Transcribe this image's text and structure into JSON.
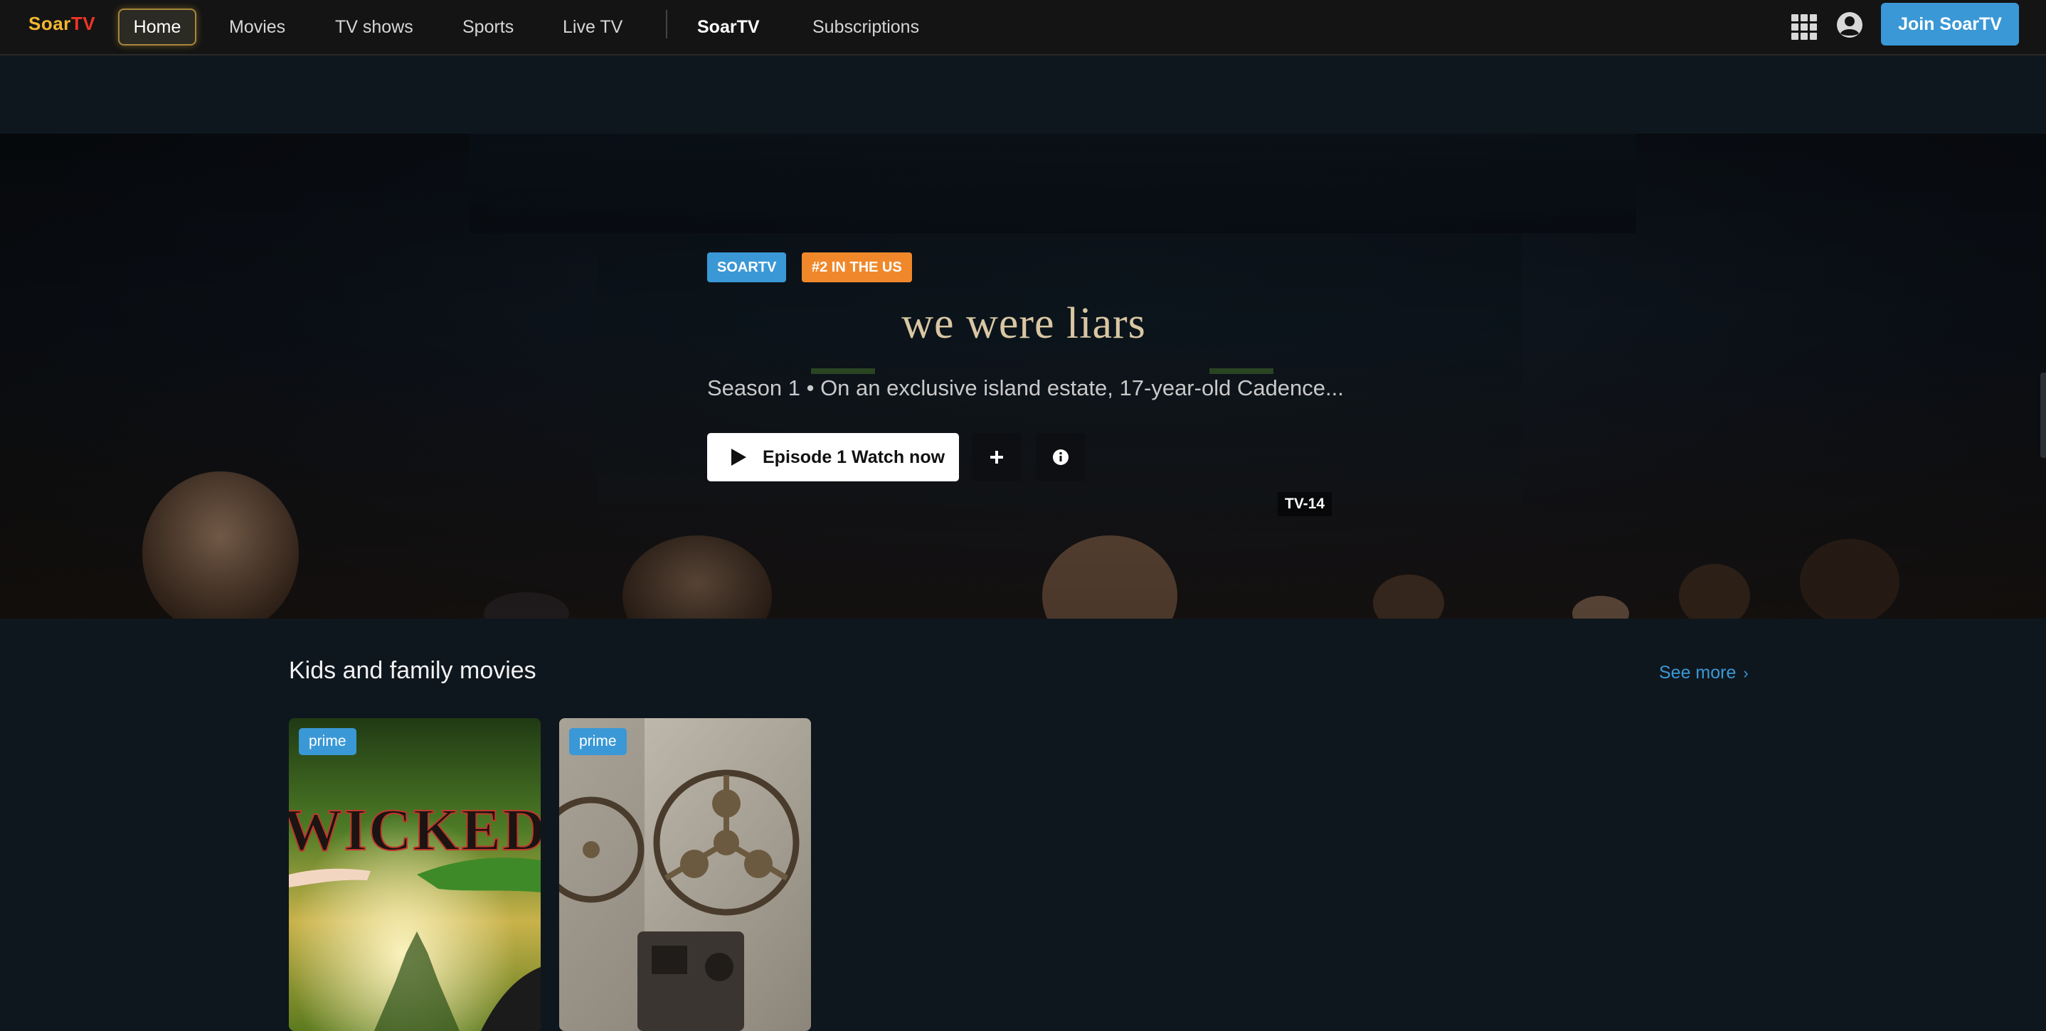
{
  "nav": {
    "logo_part1": "Soar",
    "logo_part2": "TV",
    "items": [
      "Home",
      "Movies",
      "TV shows",
      "Sports",
      "Live TV"
    ],
    "brand": "SoarTV",
    "subscriptions": "Subscriptions",
    "join_label": "Join SoarTV",
    "icons": [
      "grid-menu-icon",
      "account-icon"
    ]
  },
  "hero": {
    "badge_service": "SOARTV",
    "badge_rank": "#2 IN THE US",
    "title": "we were liars",
    "description": "Season 1 • On an exclusive island estate, 17-year-old Cadence...",
    "watch_label": "Episode 1 Watch now",
    "rating": "TV-14",
    "icons": [
      "play-icon",
      "plus-icon",
      "info-icon"
    ]
  },
  "row": {
    "title": "Kids and family movies",
    "see_more": "See more",
    "cards": [
      {
        "badge": "prime",
        "poster_text": "WICKED"
      },
      {
        "badge": "prime"
      }
    ]
  },
  "colors": {
    "accent": "#3a98d6",
    "rank_badge": "#f0882b",
    "background": "#0f171e",
    "nav_bg": "#141414"
  }
}
